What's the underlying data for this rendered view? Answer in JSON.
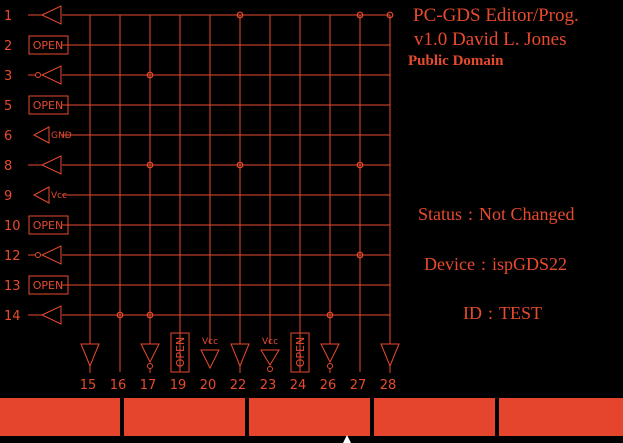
{
  "header": {
    "title_line1": "PC-GDS Editor/Prog.",
    "title_line2": "v1.0  David L. Jones",
    "title_line3": "Public Domain"
  },
  "info": {
    "status_label": "Status",
    "status_value": "Not Changed",
    "device_label": "Device",
    "device_value": "ispGDS22",
    "id_label": "ID",
    "id_value": "TEST",
    "separator": ":"
  },
  "colors": {
    "trace": "#e84a2e",
    "button": "#e5452c",
    "background": "#000000"
  },
  "left_pins": [
    {
      "number": "1",
      "type": "buffer"
    },
    {
      "number": "2",
      "type": "open",
      "label": "OPEN"
    },
    {
      "number": "3",
      "type": "inverter"
    },
    {
      "number": "5",
      "type": "open",
      "label": "OPEN"
    },
    {
      "number": "6",
      "type": "power",
      "label": "GND"
    },
    {
      "number": "8",
      "type": "buffer"
    },
    {
      "number": "9",
      "type": "power",
      "label": "Vcc"
    },
    {
      "number": "10",
      "type": "open",
      "label": "OPEN"
    },
    {
      "number": "12",
      "type": "inverter"
    },
    {
      "number": "13",
      "type": "open",
      "label": "OPEN"
    },
    {
      "number": "14",
      "type": "buffer"
    }
  ],
  "bottom_pins": [
    {
      "number": "15",
      "type": "buffer"
    },
    {
      "number": "16",
      "type": "none"
    },
    {
      "number": "17",
      "type": "inverter"
    },
    {
      "number": "19",
      "type": "open",
      "label": "OPEN"
    },
    {
      "number": "20",
      "type": "power_buffer",
      "label": "Vcc"
    },
    {
      "number": "22",
      "type": "buffer"
    },
    {
      "number": "23",
      "type": "power_inverter",
      "label": "Vcc"
    },
    {
      "number": "24",
      "type": "open",
      "label": "OPEN"
    },
    {
      "number": "26",
      "type": "inverter"
    },
    {
      "number": "27",
      "type": "none"
    },
    {
      "number": "28",
      "type": "buffer"
    }
  ],
  "connections": [
    {
      "row": "1",
      "col": "22"
    },
    {
      "row": "1",
      "col": "27"
    },
    {
      "row": "1",
      "col": "28"
    },
    {
      "row": "3",
      "col": "17"
    },
    {
      "row": "8",
      "col": "17"
    },
    {
      "row": "8",
      "col": "22"
    },
    {
      "row": "8",
      "col": "27"
    },
    {
      "row": "12",
      "col": "27"
    },
    {
      "row": "14",
      "col": "16"
    },
    {
      "row": "14",
      "col": "17"
    },
    {
      "row": "14",
      "col": "26"
    }
  ],
  "function_keys": [
    {
      "label": ""
    },
    {
      "label": ""
    },
    {
      "label": ""
    },
    {
      "label": ""
    },
    {
      "label": ""
    }
  ]
}
